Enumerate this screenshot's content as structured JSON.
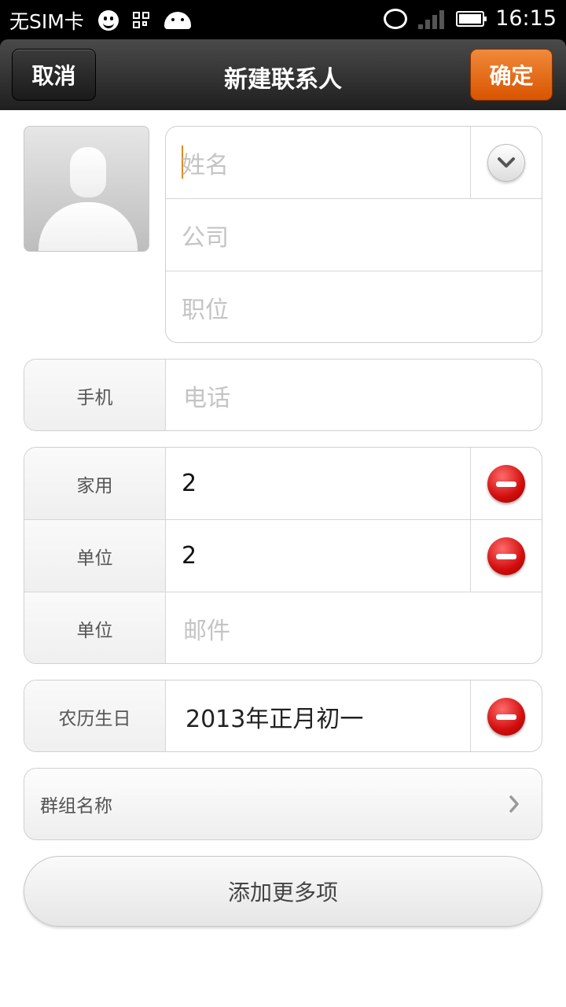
{
  "statusbar": {
    "carrier": "无SIM卡",
    "time": "16:15"
  },
  "titlebar": {
    "cancel_label": "取消",
    "title": "新建联系人",
    "ok_label": "确定"
  },
  "name_card": {
    "name_placeholder": "姓名",
    "company_placeholder": "公司",
    "position_placeholder": "职位"
  },
  "phone_card": {
    "label": "手机",
    "placeholder": "电话"
  },
  "extra_card": {
    "rows": [
      {
        "label": "家用",
        "value": "2"
      },
      {
        "label": "单位",
        "value": "2"
      },
      {
        "label": "单位",
        "placeholder": "邮件"
      }
    ]
  },
  "birthday_card": {
    "label": "农历生日",
    "value": "2013年正月初一"
  },
  "group_card": {
    "label": "群组名称"
  },
  "more_button": {
    "label": "添加更多项"
  },
  "colors": {
    "accent": "#e06a10",
    "remove": "#d10d0d"
  }
}
